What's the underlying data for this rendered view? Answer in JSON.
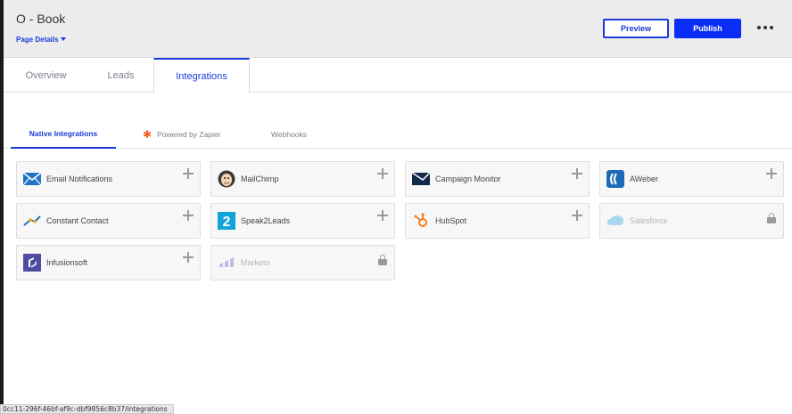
{
  "header": {
    "title": "O - Book",
    "page_details_label": "Page Details",
    "preview_label": "Preview",
    "publish_label": "Publish",
    "accent_color": "#1a3bd9",
    "publish_color": "#0a2ef5"
  },
  "tabs": [
    {
      "label": "Overview",
      "active": false
    },
    {
      "label": "Leads",
      "active": false
    },
    {
      "label": "Integrations",
      "active": true
    }
  ],
  "subtabs": [
    {
      "label": "Native Integrations",
      "active": true
    },
    {
      "label": "Powered by Zapier",
      "icon": "zapier-asterisk-icon",
      "active": false
    },
    {
      "label": "Webhooks",
      "active": false
    }
  ],
  "integrations": [
    {
      "name": "Email Notifications",
      "icon": "envelope-icon",
      "locked": false
    },
    {
      "name": "MailChimp",
      "icon": "mailchimp-icon",
      "locked": false
    },
    {
      "name": "Campaign Monitor",
      "icon": "campaign-monitor-icon",
      "locked": false
    },
    {
      "name": "AWeber",
      "icon": "aweber-icon",
      "locked": false
    },
    {
      "name": "Constant Contact",
      "icon": "constant-contact-icon",
      "locked": false
    },
    {
      "name": "Speak2Leads",
      "icon": "speak2leads-icon",
      "locked": false
    },
    {
      "name": "HubSpot",
      "icon": "hubspot-icon",
      "locked": false
    },
    {
      "name": "Salesforce",
      "icon": "salesforce-cloud-icon",
      "locked": true
    },
    {
      "name": "Infusionsoft",
      "icon": "infusionsoft-icon",
      "locked": false
    },
    {
      "name": "Marketo",
      "icon": "marketo-icon",
      "locked": true
    }
  ],
  "status_bar": {
    "url": "0cc11-296f-46bf-af9c-dbf9856c8b37/integrations"
  }
}
